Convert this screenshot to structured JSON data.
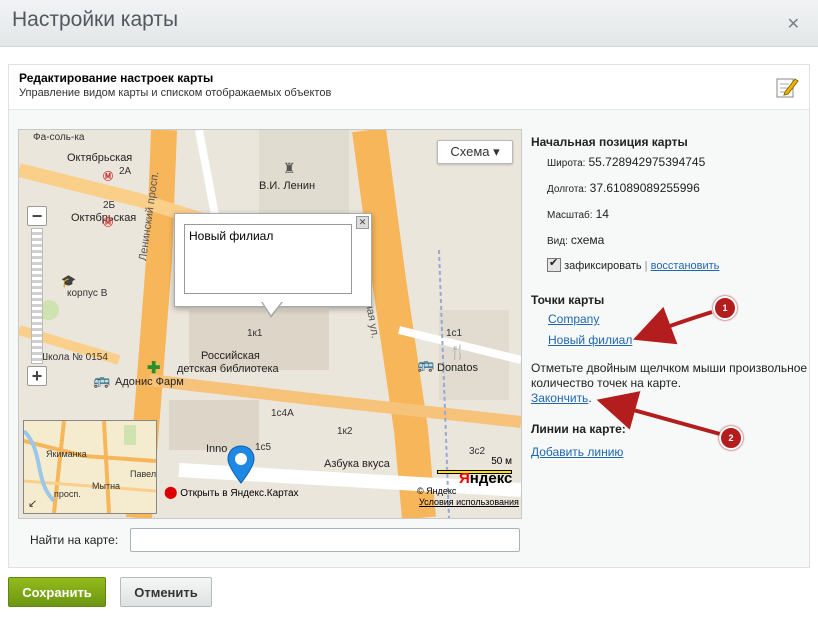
{
  "window": {
    "title": "Настройки карты",
    "close_icon": "close-icon"
  },
  "panel": {
    "title": "Редактирование настроек карты",
    "subtitle": "Управление видом карты и списком отображаемых объектов",
    "icon": "edit-pencil-icon"
  },
  "map": {
    "scheme_label": "Схема ▾",
    "zoom_in": "+",
    "zoom_out": "−",
    "balloon_text": "Новый филиал",
    "open_yandex": "Открыть в Яндекс.Картах",
    "scale_label": "50 м",
    "copyright": "© Яндекс",
    "terms": "Условия использования",
    "yandex_logo_y": "Я",
    "yandex_logo_rest": "ндекс",
    "labels": {
      "fa_sol": "Фа-соль-ка",
      "oktyabrskaya1": "Октябрьская",
      "b2a": "2А",
      "b2b": "2Б",
      "oktyabrskaya2": "Октябрьская",
      "korpus_v": "корпус В",
      "lenin": "В.И. Ленин",
      "b1k1": "1к1",
      "library1": "Российская",
      "library2": "детская библиотека",
      "pharmacy": "Адонис Фарм",
      "b1c1": "1с1",
      "donatos": "Donatos",
      "b1c4a": "1с4А",
      "b1k2": "1к2",
      "b1c5": "1с5",
      "azbuka": "Азбука вкуса",
      "inno": "Inno",
      "b3c2": "3с2",
      "school": "Школа № 0154",
      "street_leninsky": "Ленинский просп.",
      "street_mytnaya": "Мытная ул.",
      "mini_yakimanka": "Якиманка",
      "mini_pavel": "Павел",
      "mini_prosp": "просп.",
      "mini_mytna": "Мытна"
    }
  },
  "position": {
    "title": "Начальная позиция карты",
    "lat_label": "Широта:",
    "lat_value": "55.728942975394745",
    "lng_label": "Долгота:",
    "lng_value": "37.61089089255996",
    "zoom_label": "Масштаб:",
    "zoom_value": "14",
    "view_label": "Вид:",
    "view_value": "схема",
    "fix_label": "зафиксировать",
    "separator": "|",
    "restore_label": "восстановить"
  },
  "points": {
    "title": "Точки карты",
    "items": [
      "Company",
      "Новый филиал"
    ],
    "note": "Отметьте двойным щелчком мыши произвольное количество точек на карте.",
    "finish_label": "Закончить",
    "finish_suffix": "."
  },
  "lines": {
    "title": "Линии на карте:",
    "add_label": "Добавить линию"
  },
  "annotations": {
    "badge1": "1",
    "badge2": "2",
    "color": "#b41d1d"
  },
  "search": {
    "label": "Найти на карте:",
    "value": ""
  },
  "buttons": {
    "save": "Сохранить",
    "cancel": "Отменить"
  }
}
